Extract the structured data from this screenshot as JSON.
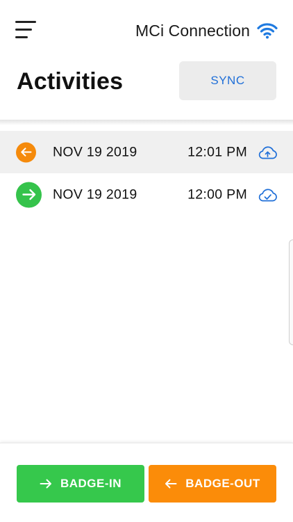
{
  "header": {
    "connection_label": "MCi Connection",
    "menu_icon": "hamburger-menu-icon",
    "wifi_icon": "wifi-icon"
  },
  "page": {
    "title": "Activities",
    "sync_label": "SYNC"
  },
  "activities": [
    {
      "direction": "out",
      "direction_icon": "arrow-left-icon",
      "date": "NOV 19 2019",
      "time": "12:01 PM",
      "status_icon": "cloud-upload-icon",
      "selected": true
    },
    {
      "direction": "in",
      "direction_icon": "arrow-right-icon",
      "date": "NOV 19 2019",
      "time": "12:00 PM",
      "status_icon": "cloud-check-icon",
      "selected": false
    }
  ],
  "footer": {
    "badge_in_label": "BADGE-IN",
    "badge_out_label": "BADGE-OUT"
  },
  "colors": {
    "accent_blue": "#1f6fd8",
    "badge_in_green": "#36c84c",
    "badge_out_orange": "#fb8c09",
    "sync_button_bg": "#ececec"
  }
}
